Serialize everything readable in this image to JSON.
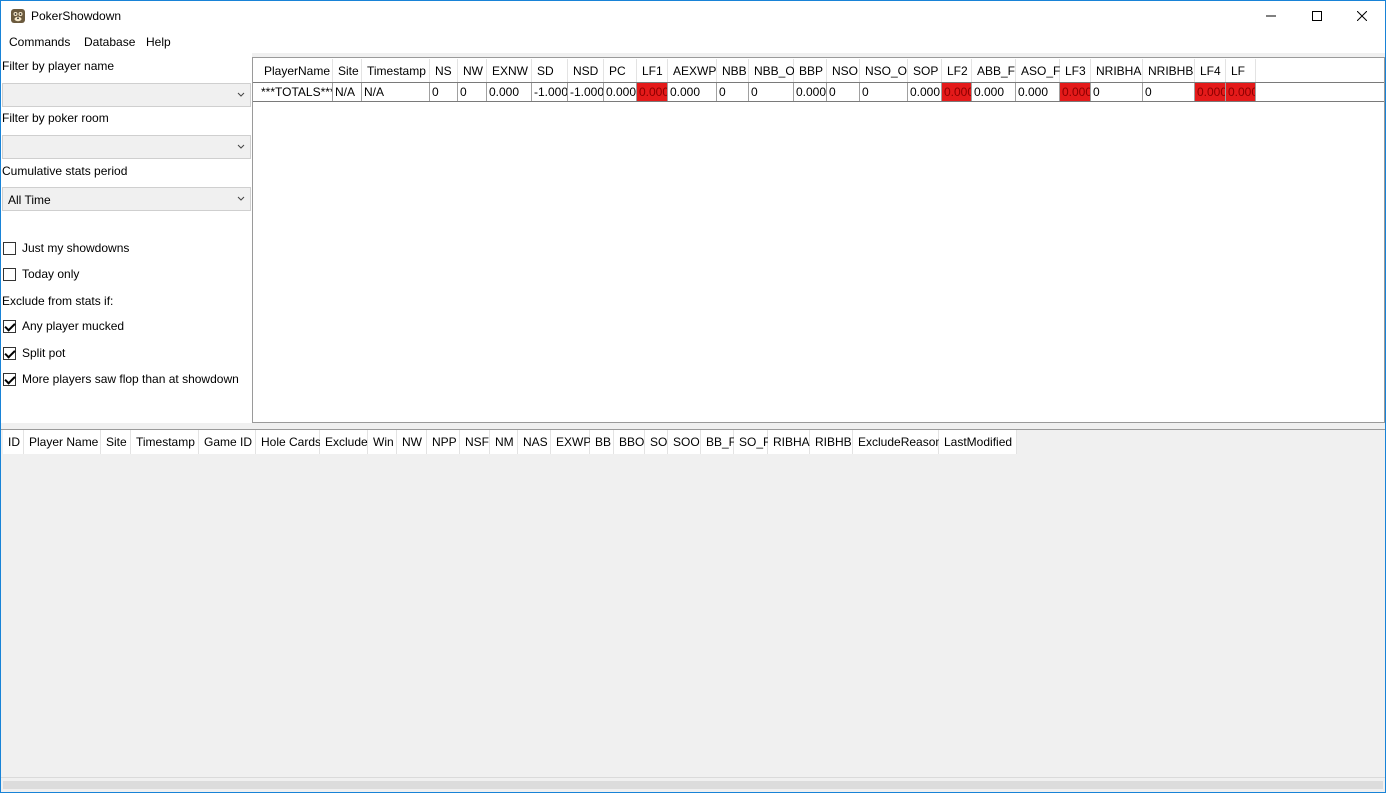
{
  "window": {
    "title": "PokerShowdown",
    "controls": {
      "minimize": "minimize-icon",
      "maximize": "maximize-icon",
      "close": "close-icon"
    }
  },
  "menu": [
    "Commands",
    "Database",
    "Help"
  ],
  "filters": {
    "player_name_label": "Filter by player name",
    "player_name_value": "",
    "poker_room_label": "Filter by poker room",
    "poker_room_value": "",
    "period_label": "Cumulative stats period",
    "period_value": "All Time",
    "just_my_showdowns": {
      "label": "Just my showdowns",
      "checked": false
    },
    "today_only": {
      "label": "Today only",
      "checked": false
    },
    "exclude_label": "Exclude from stats if:",
    "any_player_mucked": {
      "label": "Any player mucked",
      "checked": true
    },
    "split_pot": {
      "label": "Split pot",
      "checked": true
    },
    "more_players_saw_flop": {
      "label": "More players saw flop than at showdown",
      "checked": true
    }
  },
  "stats_table": {
    "columns": [
      "PlayerName",
      "Site",
      "Timestamp",
      "NS",
      "NW",
      "EXNW",
      "SD",
      "NSD",
      "PC",
      "LF1",
      "AEXWP",
      "NBB",
      "NBB_O",
      "BBP",
      "NSO",
      "NSO_O",
      "SOP",
      "LF2",
      "ABB_F",
      "ASO_F",
      "LF3",
      "NRIBHA",
      "NRIBHB",
      "LF4",
      "LF"
    ],
    "rows": [
      [
        "***TOTALS***",
        "N/A",
        "N/A",
        "0",
        "0",
        "0.000",
        "-1.000",
        "-1.000",
        "0.000",
        "0.000",
        "0.000",
        "0",
        "0",
        "0.000",
        "0",
        "0",
        "0.000",
        "0.000",
        "0.000",
        "0.000",
        "0.000",
        "0",
        "0",
        "0.000",
        "0.000"
      ]
    ],
    "highlight_color": "#e41a1a"
  },
  "showdowns_table": {
    "columns": [
      "ID",
      "Player Name",
      "Site",
      "Timestamp",
      "Game ID",
      "Hole Cards",
      "Exclude",
      "Win",
      "NW",
      "NPP",
      "NSF",
      "NM",
      "NAS",
      "EXWP",
      "BB",
      "BBO",
      "SO",
      "SOO",
      "BB_F",
      "SO_F",
      "RIBHA",
      "RIBHB",
      "ExcludeReason",
      "LastModified"
    ]
  }
}
